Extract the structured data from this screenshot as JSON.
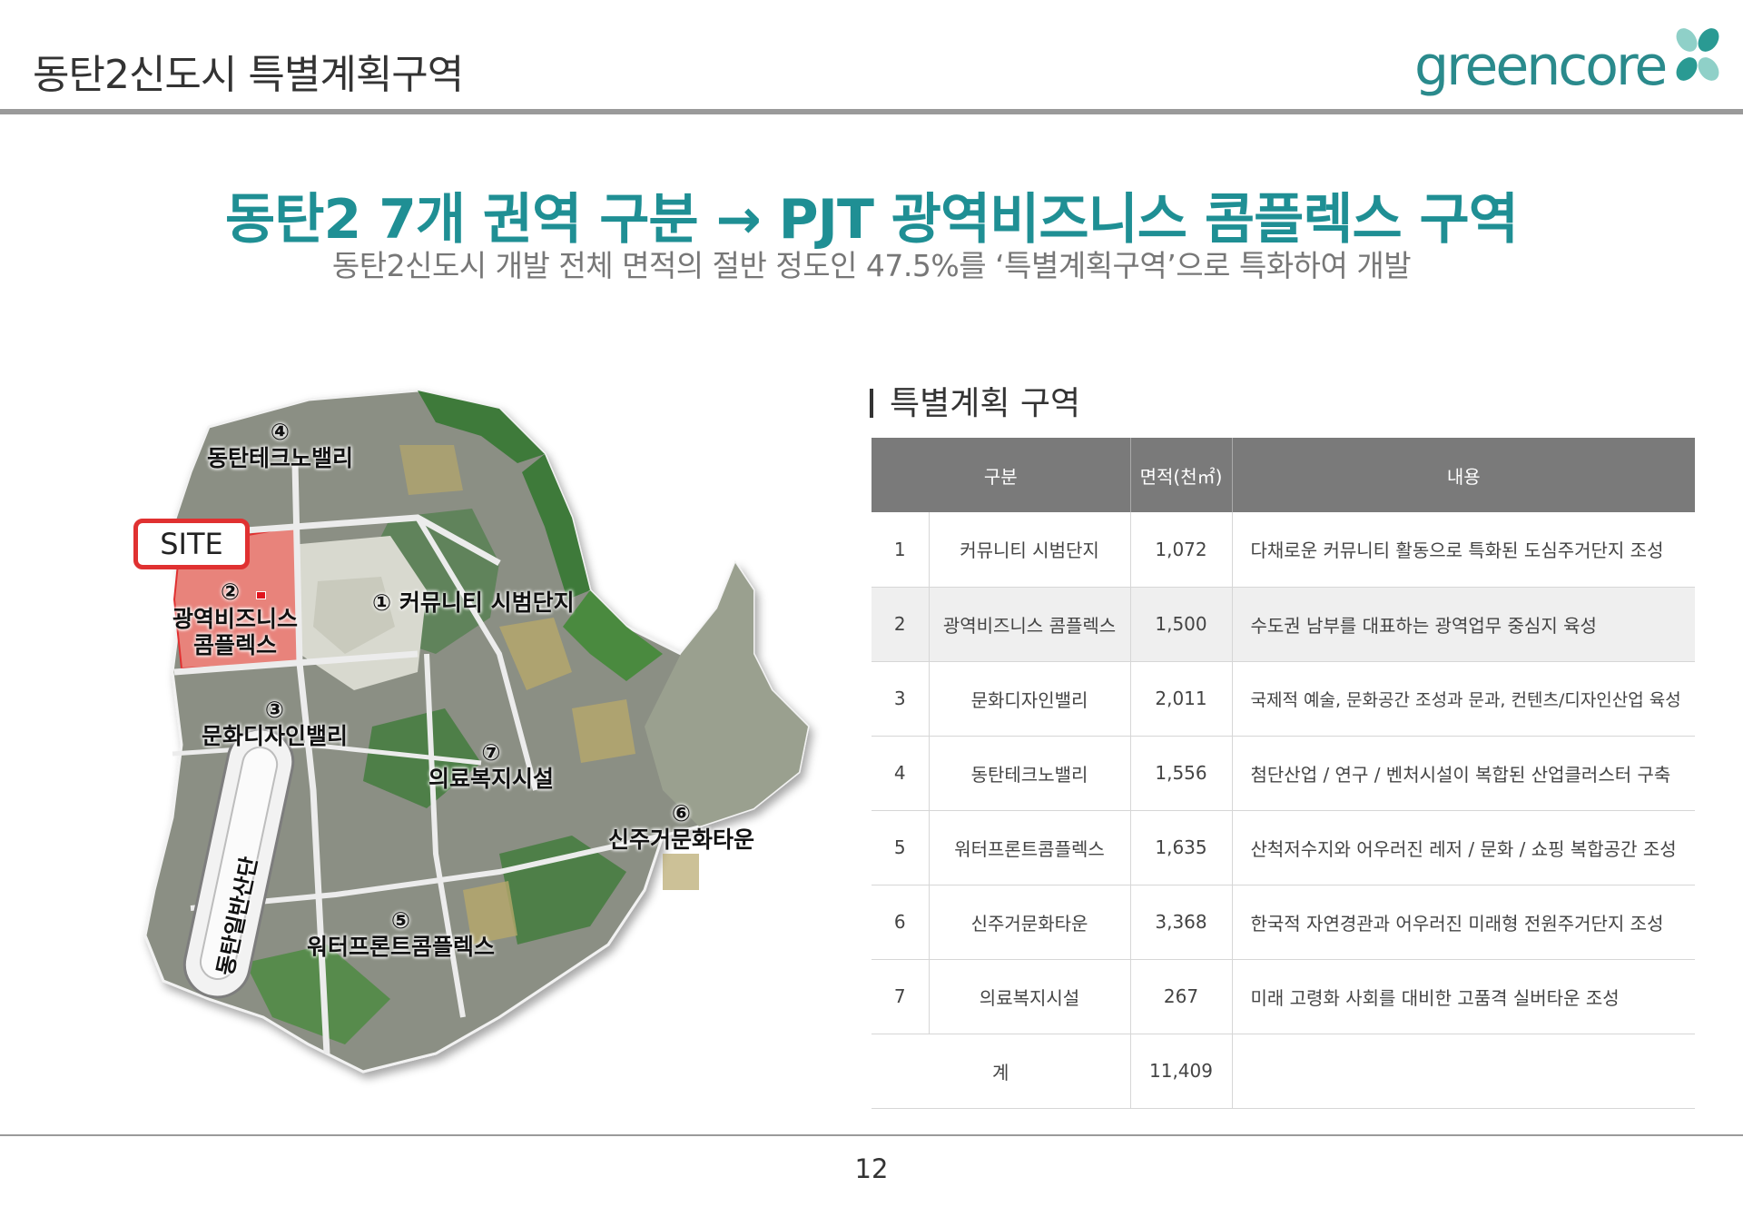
{
  "header": {
    "title": "동탄2신도시 특별계획구역",
    "logo_text": "greencore"
  },
  "headline": "동탄2 7개 권역 구분 → PJT 광역비즈니스 콤플렉스 구역",
  "subline": "동탄2신도시 개발 전체 면적의 절반 정도인 47.5%를 ‘특별계획구역’으로 특화하여 개발",
  "map": {
    "site_label": "SITE",
    "zones": [
      {
        "num": "④",
        "name": "동탄테크노밸리"
      },
      {
        "num": "②",
        "name": "광역비즈니스 콤플렉스"
      },
      {
        "num": "①",
        "name": "커뮤니티 시범단지"
      },
      {
        "num": "③",
        "name": "문화디자인밸리"
      },
      {
        "num": "⑦",
        "name": "의료복지시설"
      },
      {
        "num": "⑥",
        "name": "신주거문화타운"
      },
      {
        "num": "⑤",
        "name": "워터프론트콤플렉스"
      }
    ],
    "zone2_line1": "광역비즈니스",
    "zone2_line2": "콤플렉스",
    "zone1_label": "① 커뮤니티 시범단지",
    "ring_road_label": "동탄일반산단",
    "colors": {
      "site_zone": "#e8837b",
      "green": "#3f7a3a",
      "developed": "#8a8f86",
      "road": "#e6e6e6",
      "site_border": "#e03131"
    }
  },
  "section_title": "특별계획 구역",
  "table": {
    "headers": [
      "구분",
      "면적(천㎡)",
      "내용"
    ],
    "rows": [
      {
        "no": "1",
        "name": "커뮤니티 시범단지",
        "area": "1,072",
        "desc": "다채로운 커뮤니티 활동으로 특화된 도심주거단지 조성"
      },
      {
        "no": "2",
        "name": "광역비즈니스 콤플렉스",
        "area": "1,500",
        "desc": "수도권 남부를 대표하는 광역업무 중심지 육성"
      },
      {
        "no": "3",
        "name": "문화디자인밸리",
        "area": "2,011",
        "desc": "국제적 예술, 문화공간 조성과 문과, 컨텐츠/디자인산업 육성"
      },
      {
        "no": "4",
        "name": "동탄테크노밸리",
        "area": "1,556",
        "desc": "첨단산업 / 연구 / 벤처시설이 복합된 산업클러스터 구축"
      },
      {
        "no": "5",
        "name": "워터프론트콤플렉스",
        "area": "1,635",
        "desc": "산척저수지와 어우러진 레저 / 문화 / 쇼핑 복합공간 조성"
      },
      {
        "no": "6",
        "name": "신주거문화타운",
        "area": "3,368",
        "desc": "한국적 자연경관과 어우러진 미래형 전원주거단지 조성"
      },
      {
        "no": "7",
        "name": "의료복지시설",
        "area": "267",
        "desc": "미래 고령화 사회를 대비한 고품격 실버타운 조성"
      }
    ],
    "total": {
      "label": "계",
      "area": "11,409",
      "desc": ""
    }
  },
  "page_number": "12"
}
